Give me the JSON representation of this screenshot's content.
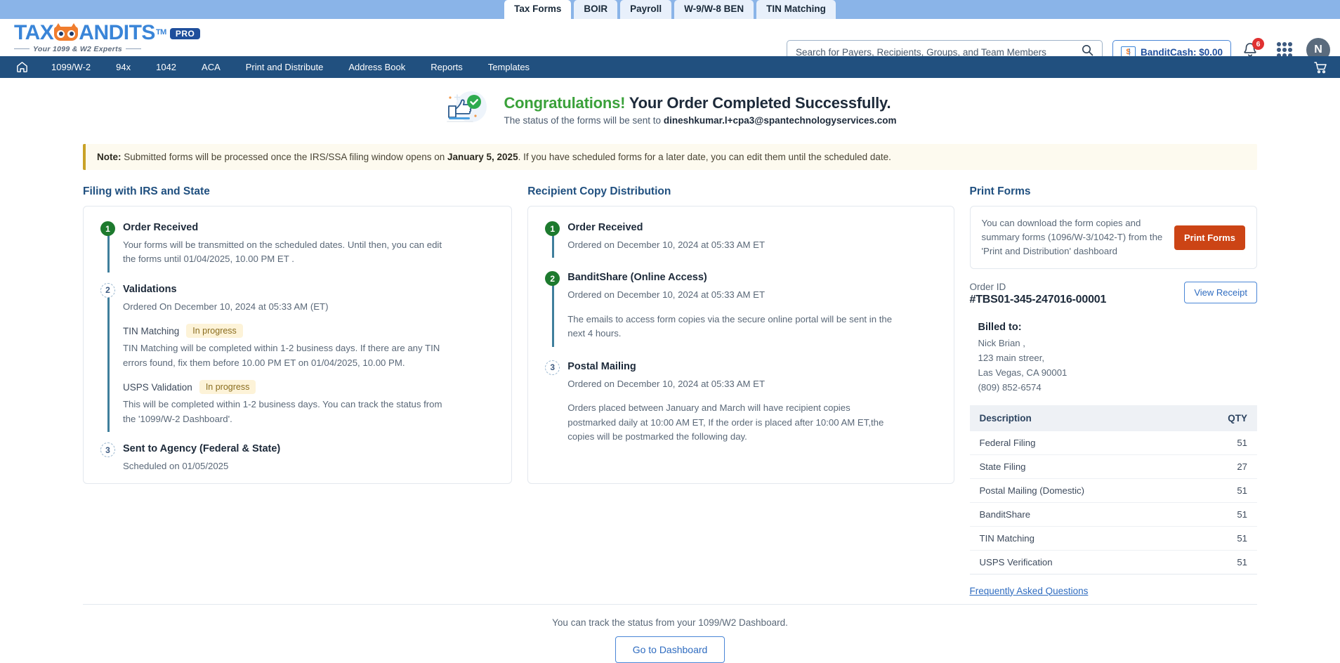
{
  "browser_tabs": [
    {
      "label": "Tax Forms",
      "active": true
    },
    {
      "label": "BOIR",
      "active": false
    },
    {
      "label": "Payroll",
      "active": false
    },
    {
      "label": "W-9/W-8 BEN",
      "active": false
    },
    {
      "label": "TIN Matching",
      "active": false
    }
  ],
  "header": {
    "logo_text": "TAX",
    "logo_text2": "ANDITS",
    "logo_tm": "TM",
    "logo_pro": "PRO",
    "logo_tagline": "Your 1099 & W2 Experts",
    "search_placeholder": "Search for Payers, Recipients, Groups, and Team Members",
    "search_value": "",
    "banditcash_label": "BanditCash: $0.00",
    "banditcash_icon_text": "$",
    "notification_count": "6",
    "avatar_initial": "N"
  },
  "nav": {
    "items": [
      {
        "label": "1099/W-2"
      },
      {
        "label": "94x"
      },
      {
        "label": "1042"
      },
      {
        "label": "ACA"
      },
      {
        "label": "Print and Distribute"
      },
      {
        "label": "Address Book"
      },
      {
        "label": "Reports"
      },
      {
        "label": "Templates"
      }
    ]
  },
  "congrats": {
    "title_green": "Congratulations!",
    "title_rest": "Your Order Completed Successfully.",
    "subtitle_prefix": "The status of the forms will be sent to ",
    "email": "dineshkumar.l+cpa3@spantechnologyservices.com"
  },
  "note": {
    "label": "Note:",
    "text_before": " Submitted forms will be processed once the IRS/SSA filing window opens on ",
    "bold_date": "January 5, 2025",
    "text_after": ". If you have scheduled forms for a later date, you can edit them until the scheduled date."
  },
  "filing": {
    "title": "Filing with IRS and State",
    "steps": [
      {
        "num": "1",
        "state": "done",
        "title": "Order Received",
        "desc": "Your forms will be transmitted on the scheduled dates. Until then, you can edit the forms until 01/04/2025, 10.00 PM ET ."
      },
      {
        "num": "2",
        "state": "pending",
        "title": "Validations",
        "desc": "Ordered On December 10, 2024 at 05:33 AM (ET)",
        "subs": [
          {
            "label": "TIN Matching",
            "chip": "In progress",
            "desc": "TIN Matching will be completed within 1-2 business days. If there are any TIN errors found, fix them before 10.00 PM ET on 01/04/2025, 10.00 PM."
          },
          {
            "label": "USPS Validation",
            "chip": "In progress",
            "desc": "This will be completed within 1-2 business days. You can track the status from the '1099/W-2 Dashboard'."
          }
        ]
      },
      {
        "num": "3",
        "state": "pending",
        "title": "Sent to Agency (Federal & State)",
        "desc": "Scheduled on 01/05/2025"
      }
    ]
  },
  "distribution": {
    "title": "Recipient Copy Distribution",
    "steps": [
      {
        "num": "1",
        "state": "done",
        "title": "Order Received",
        "desc": "Ordered on December 10, 2024 at 05:33 AM ET",
        "desc2": ""
      },
      {
        "num": "2",
        "state": "done",
        "title": "BanditShare (Online Access)",
        "desc": "Ordered on December 10, 2024 at 05:33 AM ET",
        "desc2": "The emails to access form copies via the secure online portal will be sent in the next 4 hours."
      },
      {
        "num": "3",
        "state": "pending",
        "title": "Postal Mailing",
        "desc": "Ordered on December 10, 2024 at 05:33 AM ET",
        "desc2": "Orders placed between January and March will have recipient copies postmarked daily at 10:00 AM ET, If the order is placed after 10:00 AM ET,the copies will be postmarked the following day."
      }
    ]
  },
  "print_forms": {
    "title": "Print Forms",
    "desc": "You can download the form copies and summary forms (1096/W-3/1042-T) from the 'Print and Distribution' dashboard",
    "button": "Print Forms",
    "order_id_label": "Order ID",
    "order_id": "#TBS01-345-247016-00001",
    "view_receipt": "View Receipt",
    "billed_to_label": "Billed to:",
    "billed_name": "Nick Brian ,",
    "billed_street": "123 main streer,",
    "billed_city": "Las Vegas, CA 90001",
    "billed_phone": "(809) 852-6574",
    "table": {
      "headers": [
        "Description",
        "QTY"
      ],
      "rows": [
        {
          "description": "Federal Filing",
          "qty": "51"
        },
        {
          "description": "State Filing",
          "qty": "27"
        },
        {
          "description": "Postal Mailing (Domestic)",
          "qty": "51"
        },
        {
          "description": "BanditShare",
          "qty": "51"
        },
        {
          "description": "TIN Matching",
          "qty": "51"
        },
        {
          "description": "USPS Verification",
          "qty": "51"
        }
      ]
    },
    "faq_link": "Frequently Asked Questions"
  },
  "footer": {
    "text": "You can track the status from your 1099/W2 Dashboard.",
    "button": "Go to Dashboard"
  },
  "colors": {
    "nav_blue": "#21507f",
    "tabstrip_blue": "#8ab4e8",
    "accent_orange": "#cc4415",
    "link_blue": "#2f6cc0",
    "success_green": "#1d7a2e",
    "chip_bg": "#fdf3d8"
  }
}
